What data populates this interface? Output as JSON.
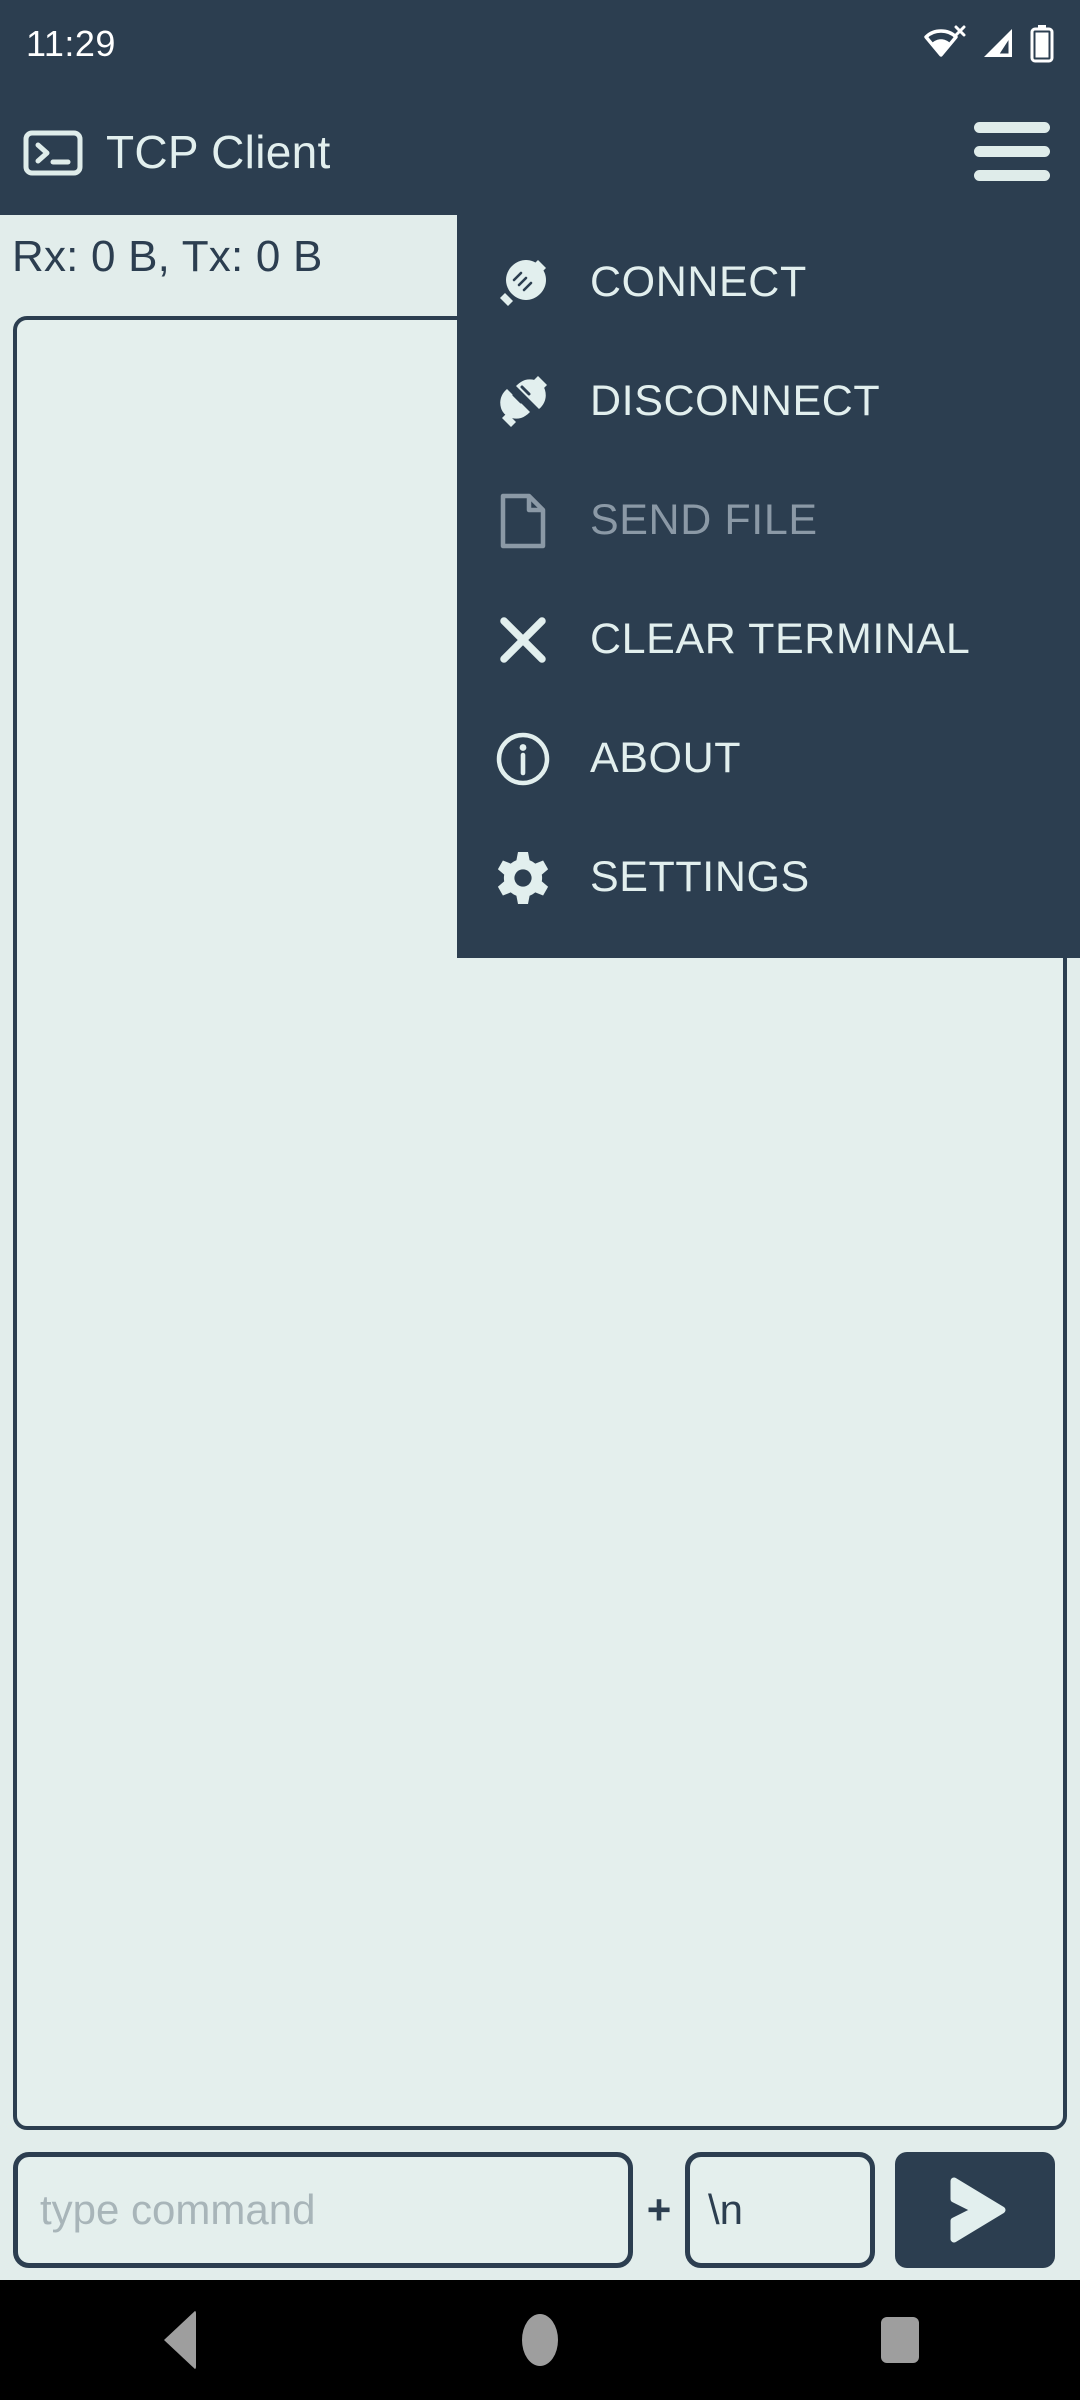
{
  "status_bar": {
    "clock": "11:29",
    "icons": [
      "wifi-off-icon",
      "cellular-signal-icon",
      "battery-icon"
    ]
  },
  "app_bar": {
    "icon": "terminal-icon",
    "title": "TCP Client",
    "menu_icon": "hamburger-menu-icon"
  },
  "main": {
    "stats": "Rx: 0 B, Tx: 0 B",
    "terminal_text": ""
  },
  "input_bar": {
    "command_placeholder": "type command",
    "command_value": "",
    "plus": "+",
    "terminator_value": "\\n",
    "send_icon": "send-chevron-icon"
  },
  "overflow_menu": {
    "visible": true,
    "items": [
      {
        "label": "CONNECT",
        "icon": "plug-connected-icon",
        "enabled": true
      },
      {
        "label": "DISCONNECT",
        "icon": "plug-disconnected-icon",
        "enabled": true
      },
      {
        "label": "SEND FILE",
        "icon": "file-document-icon",
        "enabled": false
      },
      {
        "label": "CLEAR TERMINAL",
        "icon": "close-x-icon",
        "enabled": true
      },
      {
        "label": "ABOUT",
        "icon": "info-circle-icon",
        "enabled": true
      },
      {
        "label": "SETTINGS",
        "icon": "gear-icon",
        "enabled": true
      }
    ]
  },
  "nav_bar": {
    "back": "back-triangle-icon",
    "home": "home-circle-icon",
    "recents": "recents-square-icon"
  },
  "colors": {
    "primary_dark": "#2c3e50",
    "background_light": "#e2edeb",
    "text_light": "#e2efee",
    "text_disabled": "#8b99a6",
    "placeholder": "#a8b5b9",
    "nav_bar_bg": "#000000",
    "nav_icon": "#9e9e9e"
  }
}
